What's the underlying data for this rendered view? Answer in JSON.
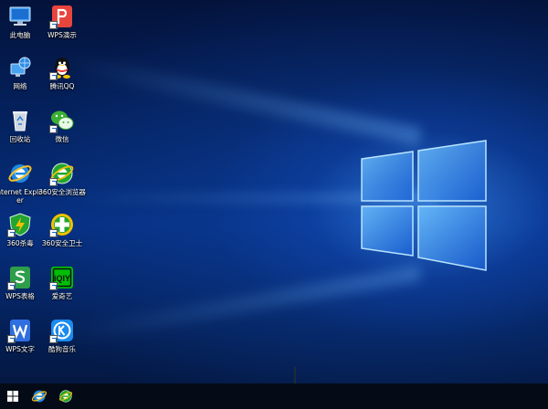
{
  "desktop": {
    "icons": [
      {
        "label": "此电脑",
        "icon": "computer-icon"
      },
      {
        "label": "WPS演示",
        "icon": "wps-presentation-icon"
      },
      {
        "label": "网络",
        "icon": "network-icon"
      },
      {
        "label": "腾讯QQ",
        "icon": "qq-icon"
      },
      {
        "label": "回收站",
        "icon": "recycle-bin-icon"
      },
      {
        "label": "微信",
        "icon": "wechat-icon"
      },
      {
        "label": "Internet Explorer",
        "icon": "internet-explorer-icon"
      },
      {
        "label": "360安全浏览器",
        "icon": "360-browser-icon"
      },
      {
        "label": "360杀毒",
        "icon": "360-antivirus-icon"
      },
      {
        "label": "360安全卫士",
        "icon": "360-security-icon"
      },
      {
        "label": "WPS表格",
        "icon": "wps-spreadsheet-icon"
      },
      {
        "label": "爱奇艺",
        "icon": "iqiyi-icon"
      },
      {
        "label": "WPS文字",
        "icon": "wps-writer-icon"
      },
      {
        "label": "酷狗音乐",
        "icon": "kugou-icon"
      }
    ]
  },
  "taskbar": {
    "items": [
      {
        "icon": "windows-start-icon"
      },
      {
        "icon": "internet-explorer-icon"
      },
      {
        "icon": "360-browser-icon"
      }
    ]
  },
  "colors": {
    "wps_red": "#e8453c",
    "wps_green": "#2e9e4a",
    "wps_blue": "#2f6fe0",
    "qq_yellow": "#f5c400",
    "wechat_green": "#3cb034",
    "ie_blue": "#1e88e5",
    "sec360_green": "#22a531",
    "sec360_yellow": "#f0c000",
    "iqiyi_green": "#00be06",
    "kugou_blue": "#1a8bf0",
    "taskbar": "#050b16"
  }
}
